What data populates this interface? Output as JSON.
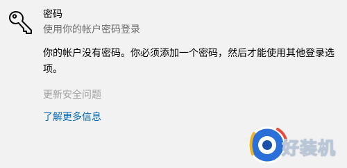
{
  "section": {
    "title": "密码",
    "subtitle": "使用你的帐户密码登录",
    "description": "你的帐户没有密码。你必须添加一个密码，然后才能使用其他登录选项。",
    "update_security_label": "更新安全问题",
    "learn_more_label": "了解更多信息",
    "icon": "key-icon"
  },
  "watermark": {
    "text": "好装机",
    "icon": "watermark-logo-icon"
  },
  "colors": {
    "background": "#f2f2f2",
    "link": "#0067b8",
    "disabled": "#a0a0a0",
    "secondary_text": "#6b6b6b"
  }
}
